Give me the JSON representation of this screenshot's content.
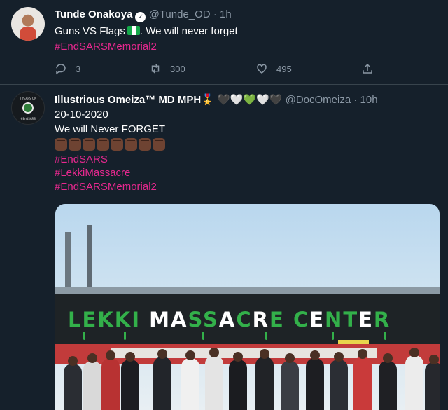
{
  "tweets": [
    {
      "author": "Tunde Onakoya",
      "handle": "@Tunde_OD",
      "time": "1h",
      "verified": true,
      "text": "Guns VS Flags",
      "text_suffix": ". We will never forget",
      "hashtags": [
        "#EndSARSMemorial2"
      ],
      "stats": {
        "replies": "3",
        "retweets": "300",
        "likes": "495"
      }
    },
    {
      "author": "Illustrious Omeiza™ MD MPH🎖️ 🖤🤍💚🤍🖤",
      "handle": "@DocOmeiza",
      "time": "10h",
      "date_line": "20-10-2020",
      "text": "We will Never FORGET",
      "hashtags": [
        "#EndSARS",
        "#LekkiMassacre",
        "#EndSARSMemorial2"
      ],
      "image": {
        "sign_text": "LEKKI MASSACRE CENTER",
        "avatar_text": "2 YEARS ON / WE WILL NEVER FORGET / #EndSARS"
      }
    }
  ],
  "colors": {
    "background": "#15202b",
    "hashtag": "#e8288f",
    "muted": "#8b98a5",
    "divider": "#38444d"
  },
  "icons": [
    "reply-icon",
    "retweet-icon",
    "like-icon",
    "share-icon",
    "verified-badge-icon",
    "nigeria-flag-icon",
    "raised-fist-icon"
  ]
}
